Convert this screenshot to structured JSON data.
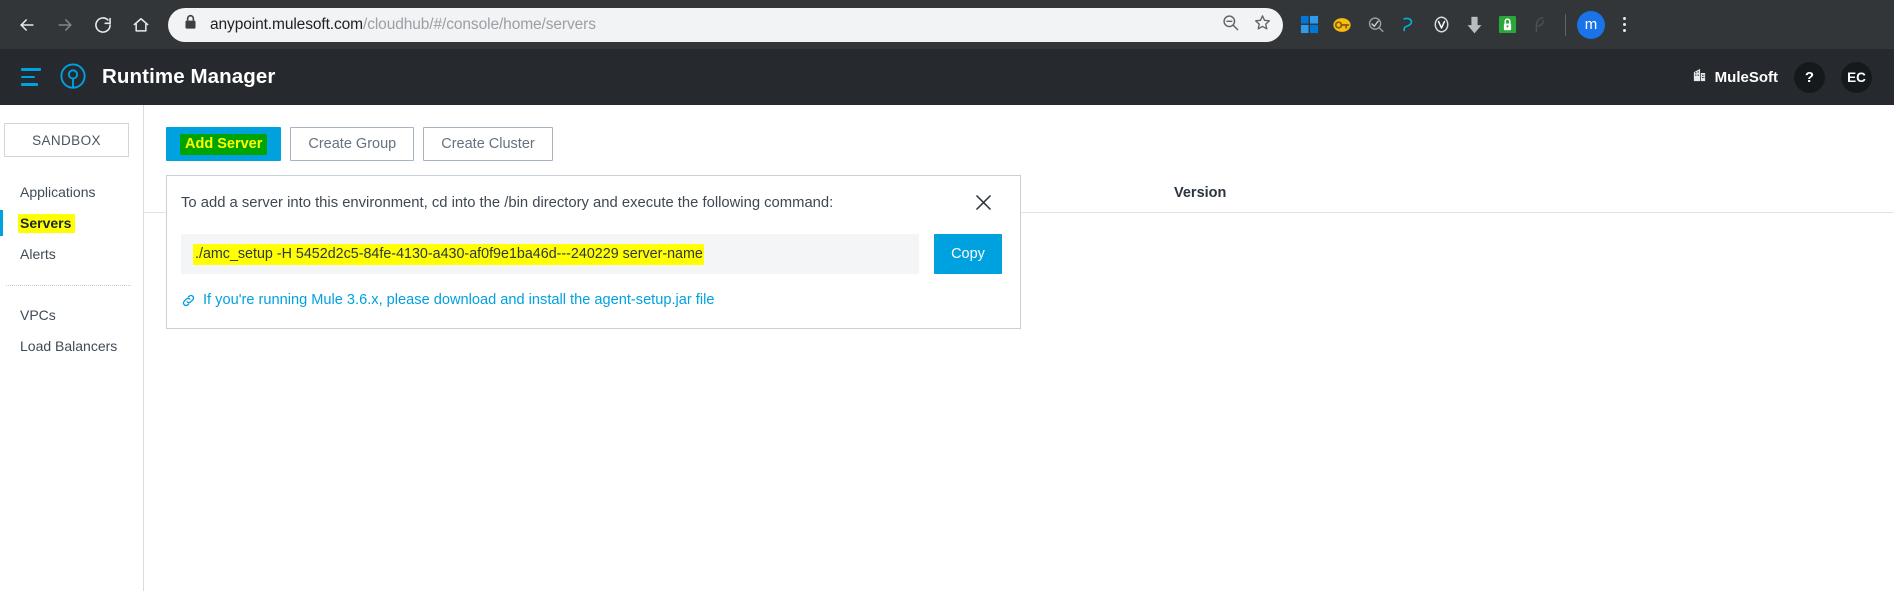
{
  "browser": {
    "back_icon": "back-arrow-icon",
    "forward_icon": "forward-arrow-icon",
    "reload_icon": "reload-icon",
    "home_icon": "home-icon",
    "lock_icon": "lock-icon",
    "url_prefix": "anypoint.mulesoft.com",
    "url_path": "/cloudhub/#/console/home/servers",
    "zoom_out_icon": "zoom-out-icon",
    "bookmark_icon": "star-icon",
    "extensions": [
      {
        "name": "windows-extension-icon"
      },
      {
        "name": "password-key-extension-icon"
      },
      {
        "name": "dark-reader-extension-icon"
      },
      {
        "name": "grammar-extension-icon"
      },
      {
        "name": "vimium-extension-icon"
      },
      {
        "name": "download-extension-icon"
      },
      {
        "name": "green-lock-extension-icon"
      },
      {
        "name": "feather-extension-icon"
      }
    ],
    "profile_initial": "m",
    "menu_icon": "three-dot-menu-icon"
  },
  "app_header": {
    "menu_icon": "hamburger-menu-icon",
    "logo_icon": "anypoint-logo-icon",
    "title": "Runtime Manager",
    "org_icon": "building-icon",
    "org_name": "MuleSoft",
    "help_label": "?",
    "avatar_initials": "EC"
  },
  "sidebar": {
    "environment": "SANDBOX",
    "items": [
      {
        "label": "Applications",
        "active": false
      },
      {
        "label": "Servers",
        "active": true
      },
      {
        "label": "Alerts",
        "active": false
      }
    ],
    "secondary_items": [
      {
        "label": "VPCs"
      },
      {
        "label": "Load Balancers"
      }
    ]
  },
  "main": {
    "buttons": {
      "add_server": "Add Server",
      "create_group": "Create Group",
      "create_cluster": "Create Cluster"
    },
    "table": {
      "version_column": "Version"
    },
    "panel": {
      "instruction": "To add a server into this environment, cd into the /bin directory and execute the following command:",
      "close_icon": "close-icon",
      "command": "./amc_setup -H 5452d2c5-84fe-4130-a430-af0f9e1ba46d---240229 server-name",
      "copy_label": "Copy",
      "link_icon": "chain-link-icon",
      "link_text": "If you're running Mule 3.6.x, please download and install the agent-setup.jar file"
    }
  },
  "colors": {
    "accent_blue": "#00a1df",
    "highlight_yellow": "#ffff00",
    "highlight_green": "#00a400",
    "chrome_dark": "#323639",
    "header_dark": "#262a2e"
  }
}
